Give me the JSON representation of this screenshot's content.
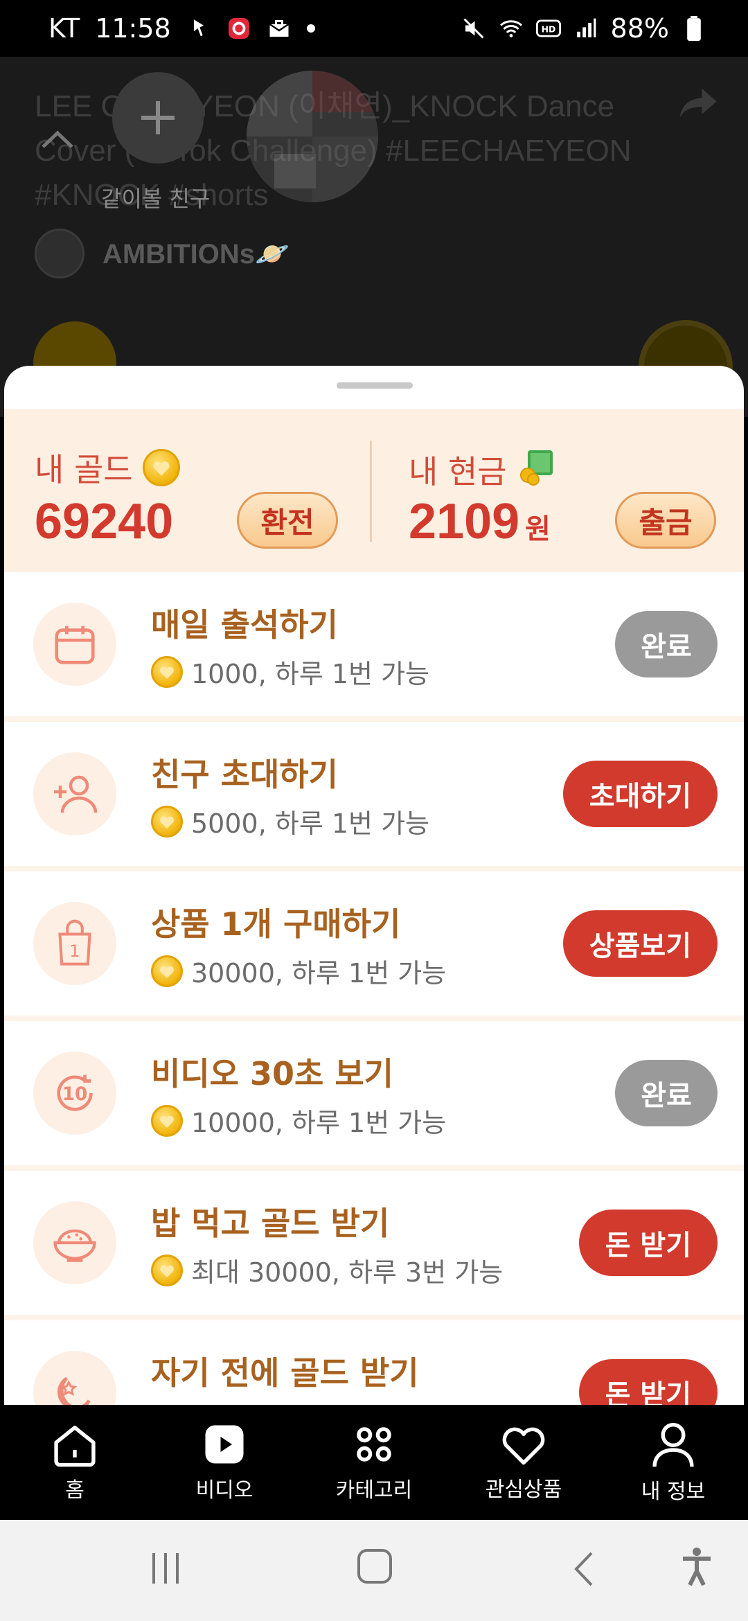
{
  "status_bar": {
    "carrier": "KT",
    "time": "11:58",
    "battery": "88%"
  },
  "video": {
    "title": "LEE CHAE YEON (이채연)_KNOCK Dance Cover (TikTok Challenge) #LEECHAEYEON #KNOCK #shorts",
    "friend_button_label": "같이볼 친구",
    "channel_name": "AMBITIONs🪐"
  },
  "wallet": {
    "gold_label": "내 골드",
    "gold_value": "69240",
    "exchange_label": "환전",
    "cash_label": "내 현금",
    "cash_value": "2109",
    "cash_unit": "원",
    "withdraw_label": "출금"
  },
  "tasks": [
    {
      "title": "매일 출석하기",
      "reward": "1000, 하루 1번 가능",
      "button": "완료",
      "state": "done",
      "icon": "calendar-icon"
    },
    {
      "title": "친구 초대하기",
      "reward": "5000, 하루 1번 가능",
      "button": "초대하기",
      "state": "active",
      "icon": "add-friend-icon"
    },
    {
      "title": "상품 1개 구매하기",
      "reward": "30000, 하루 1번 가능",
      "button": "상품보기",
      "state": "active",
      "icon": "shopping-bag-icon"
    },
    {
      "title": "비디오 30초 보기",
      "reward": "10000, 하루 1번 가능",
      "button": "완료",
      "state": "done",
      "icon": "timer-10-icon"
    },
    {
      "title": "밥 먹고 골드 받기",
      "reward": "최대 30000, 하루 3번 가능",
      "button": "돈 받기",
      "state": "active",
      "icon": "rice-bowl-icon"
    },
    {
      "title": "자기 전에 골드 받기",
      "reward": "",
      "button": "돈 받기",
      "state": "active",
      "icon": "moon-star-icon"
    }
  ],
  "bottom_nav": [
    {
      "label": "홈",
      "icon": "home-icon"
    },
    {
      "label": "비디오",
      "icon": "video-play-icon"
    },
    {
      "label": "카테고리",
      "icon": "category-icon"
    },
    {
      "label": "관심상품",
      "icon": "heart-icon"
    },
    {
      "label": "내 정보",
      "icon": "profile-icon"
    }
  ],
  "colors": {
    "accent_red": "#d23a2e",
    "done_gray": "#9a9a9a",
    "title_brown": "#a8611f",
    "balance_bg": "#fdf0e2"
  }
}
